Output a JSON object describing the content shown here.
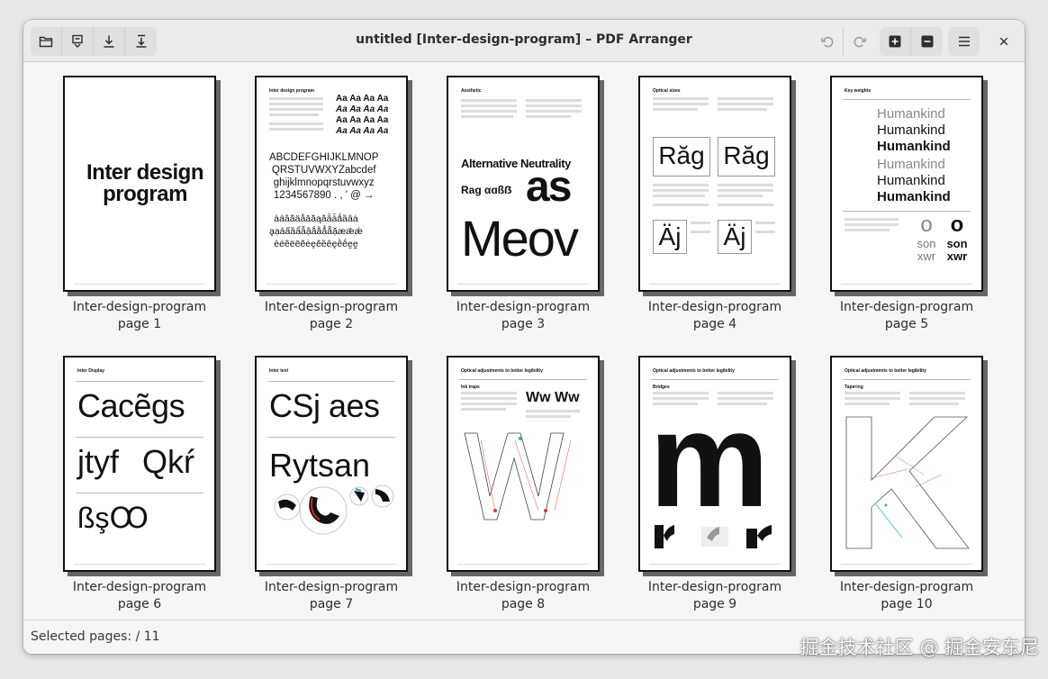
{
  "window": {
    "title": "untitled [Inter-design-program] – PDF Arranger"
  },
  "toolbar": {
    "left_icons": [
      "open-folder-icon",
      "import-icon",
      "save-icon",
      "save-as-icon"
    ],
    "history_icons": [
      "undo-icon",
      "redo-icon"
    ],
    "zoom_icons": [
      "zoom-in-icon",
      "zoom-out-icon"
    ],
    "menu_icon": "hamburger-menu-icon",
    "close_icon": "close-icon"
  },
  "pages": [
    {
      "name": "Inter-design-program",
      "label": "page 1"
    },
    {
      "name": "Inter-design-program",
      "label": "page 2"
    },
    {
      "name": "Inter-design-program",
      "label": "page 3"
    },
    {
      "name": "Inter-design-program",
      "label": "page 4"
    },
    {
      "name": "Inter-design-program",
      "label": "page 5"
    },
    {
      "name": "Inter-design-program",
      "label": "page 6"
    },
    {
      "name": "Inter-design-program",
      "label": "page 7"
    },
    {
      "name": "Inter-design-program",
      "label": "page 8"
    },
    {
      "name": "Inter-design-program",
      "label": "page 9"
    },
    {
      "name": "Inter-design-program",
      "label": "page 10"
    }
  ],
  "thumbs": {
    "p1": {
      "title": "Inter design program"
    },
    "p2": {
      "heading": "Inter design program",
      "aa": "Aa Aa Aa Aa",
      "alpha1": "ABCDEFGHIJKLMNOP",
      "alpha2": "QRSTUVWXYZabcdef",
      "alpha3": "ghijklmnopqrstuvwxyz",
      "alpha4": "1234567890 . , ' @ →",
      "accents1": "àáâãäåāăąǎǟǡǻȁȃȧ",
      "accents2": "ḁạảấầẩẫậắằẳẵặæǣǽ",
      "accents3": "èéêëēĕėęěȅȇȩḕḗḙḛ"
    },
    "p3": {
      "heading": "Aesthetic",
      "big": "Alternative Neutrality",
      "rag": "Rag αɑßẞ",
      "as": "as",
      "meow": "Meov"
    },
    "p4": {
      "heading": "Optical sizes",
      "rag1": "Răg",
      "rag2": "Răg",
      "aj1": "Äj",
      "aj2": "Äj"
    },
    "p5": {
      "heading": "Key weights",
      "hk": "Humankind",
      "o1": "o",
      "o2": "o",
      "son1": "son",
      "son2": "son",
      "xwr1": "xwr",
      "xwr2": "xwr"
    },
    "p6": {
      "heading": "Inter Display",
      "cacegs": "Cacẽgs",
      "jtyf": "jtyf",
      "qkr": "Qkŕ",
      "bsc": "ßşꝎ"
    },
    "p7": {
      "heading": "Inter text",
      "csj": "CSj aes",
      "rytsan": "Rytsan"
    },
    "p8": {
      "heading": "Optical adjustments to better legibility",
      "sub": "Ink traps",
      "ww": "Ww Ww"
    },
    "p9": {
      "heading": "Optical adjustments to better legibility",
      "sub": "Bridges",
      "m": "m"
    },
    "p10": {
      "heading": "Optical adjustments to better legibility",
      "sub": "Tapering"
    }
  },
  "status": {
    "selected_label": "Selected pages:",
    "selected_value": "/ 11"
  },
  "watermark": "掘金技术社区 @ 掘金安东尼"
}
